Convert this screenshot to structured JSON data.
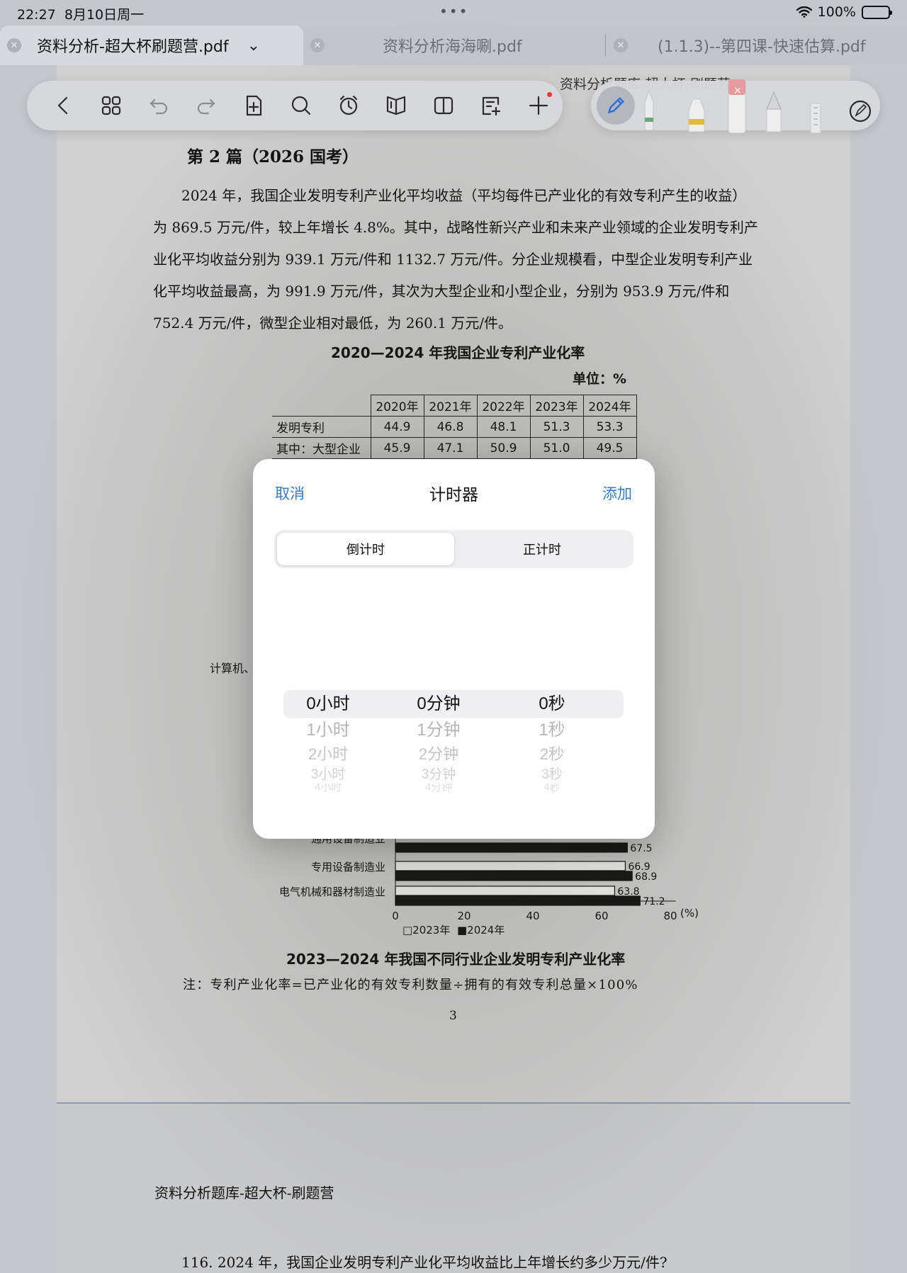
{
  "status_bar": {
    "time": "22:27",
    "date": "8月10日周一",
    "dots": "•••",
    "battery": "100%"
  },
  "tabs": [
    {
      "label": "资料分析-超大杯刷题营.pdf",
      "active": true
    },
    {
      "label": "资料分析海海唰.pdf",
      "active": false
    },
    {
      "label": "(1.1.3)--第四课-快速估算.pdf",
      "active": false
    }
  ],
  "toolbar": {
    "icons": [
      "back-icon",
      "grid-icon",
      "undo-icon",
      "redo-icon",
      "add-page-icon",
      "search-icon",
      "timer-icon",
      "book-icon",
      "split-view-icon",
      "note-icon",
      "plus-icon"
    ]
  },
  "document": {
    "header_cut": "资料分析题库-超大杯-刷题营",
    "section_title": "第 2 篇（2026 国考）",
    "paragraph": "2024 年，我国企业发明专利产业化平均收益（平均每件已产业化的有效专利产生的收益）为 869.5 万元/件，较上年增长 4.8%。其中，战略性新兴产业和未来产业领域的企业发明专利产业化平均收益分别为 939.1 万元/件和 1132.7 万元/件。分企业规模看，中型企业发明专利产业化平均收益最高，为 991.9 万元/件，其次为大型企业和小型企业，分别为 953.9 万元/件和 752.4 万元/件，微型企业相对最低，为 260.1 万元/件。",
    "table_title": "2020—2024 年我国企业专利产业化率",
    "unit": "单位：%",
    "table": {
      "columns": [
        "2020年",
        "2021年",
        "2022年",
        "2023年",
        "2024年"
      ],
      "rows": [
        {
          "label": "发明专利",
          "values": [
            "44.9",
            "46.8",
            "48.1",
            "51.3",
            "53.3"
          ]
        },
        {
          "label": "其中：大型企业",
          "values": [
            "45.9",
            "47.1",
            "50.9",
            "51.0",
            "49.5"
          ]
        }
      ]
    },
    "left_cut_label": "计算机、",
    "chart_caption": "2023—2024 年我国不同行业企业发明专利产业化率",
    "note": "注：专利产业化率=已产业化的有效专利数量÷拥有的有效专利总量×100%",
    "page_number": "3",
    "footer_title": "资料分析题库-超大杯-刷题营",
    "question": "116. 2024 年，我国企业发明专利产业化平均收益比上年增长约多少万元/件?"
  },
  "chart_data": {
    "type": "bar",
    "orientation": "horizontal",
    "categories": [
      "通用设备制造业",
      "专用设备制造业",
      "电气机械和器材制造业"
    ],
    "series": [
      {
        "name": "2023年",
        "values": [
          null,
          66.9,
          63.8
        ],
        "color": "#f4f4f4"
      },
      {
        "name": "2024年",
        "values": [
          67.5,
          68.9,
          71.2
        ],
        "color": "#141414"
      }
    ],
    "x_ticks": [
      "0",
      "20",
      "40",
      "60",
      "80"
    ],
    "x_unit": "(%)",
    "xlim": [
      0,
      80
    ],
    "legend": [
      "□2023年",
      "■2024年"
    ],
    "legend_position": "bottom-left"
  },
  "timer_dialog": {
    "cancel": "取消",
    "title": "计时器",
    "add": "添加",
    "segments": [
      "倒计时",
      "正计时"
    ],
    "selected_segment": "倒计时",
    "hours": [
      "0小时",
      "1小时",
      "2小时",
      "3小时",
      "4小时"
    ],
    "minutes": [
      "0分钟",
      "1分钟",
      "2分钟",
      "3分钟",
      "4分钟"
    ],
    "seconds": [
      "0秒",
      "1秒",
      "2秒",
      "3秒",
      "4秒"
    ],
    "accent_color": "#2f7ed8"
  }
}
